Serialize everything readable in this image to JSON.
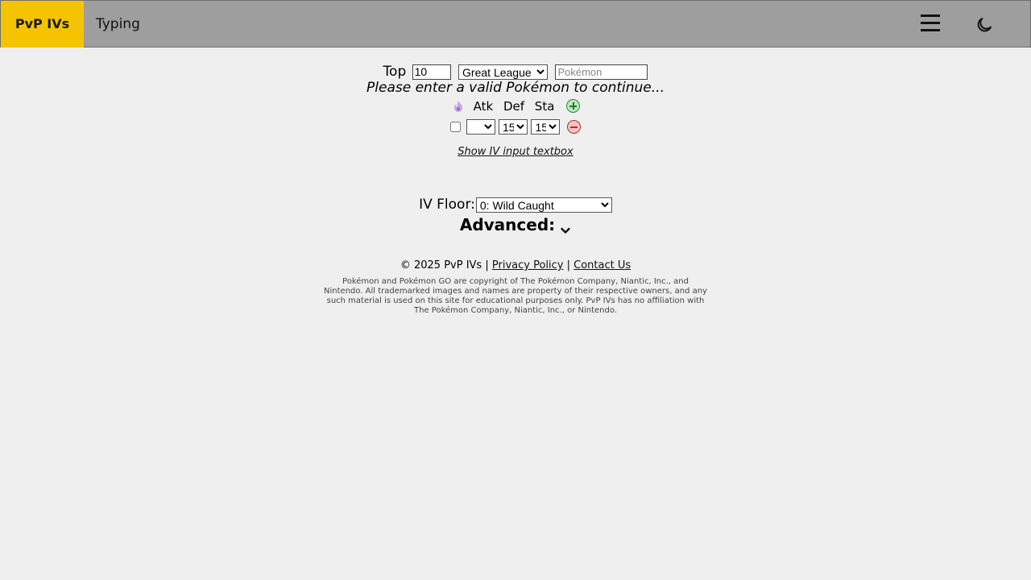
{
  "nav": {
    "brand": "PvP IVs",
    "typing_link": "Typing",
    "menu_icon": "hamburger-menu-icon",
    "theme_icon": "moon-icon"
  },
  "search": {
    "top_label": "Top",
    "top_value": "10",
    "league_selected": "Great League",
    "pokemon_placeholder": "Pokémon"
  },
  "message": "Please enter a valid Pokémon to continue...",
  "iv_table": {
    "headers": [
      "Atk",
      "Def",
      "Sta"
    ],
    "rows": [
      {
        "checked": false,
        "atk": "",
        "def": "15",
        "sta": "15"
      }
    ]
  },
  "textbox_link": "Show IV input textbox",
  "floor": {
    "label": "IV Floor:",
    "selected": "0: Wild Caught"
  },
  "advanced_label": "Advanced:",
  "footer": {
    "copyright": "© 2025 PvP IVs",
    "separator": "|",
    "privacy": "Privacy Policy",
    "contact": "Contact Us",
    "disclaimer": "Pokémon and Pokémon GO are copyright of The Pokémon Company, Niantic, Inc., and Nintendo. All trademarked images and names are property of their respective owners, and any such material is used on this site for educational purposes only. PvP IVs has no affiliation with The Pokémon Company, Niantic, Inc., or Nintendo."
  },
  "colors": {
    "brand_bg": "#f5c400",
    "navbar_bg": "#9e9e9e",
    "page_bg": "#efefef"
  }
}
